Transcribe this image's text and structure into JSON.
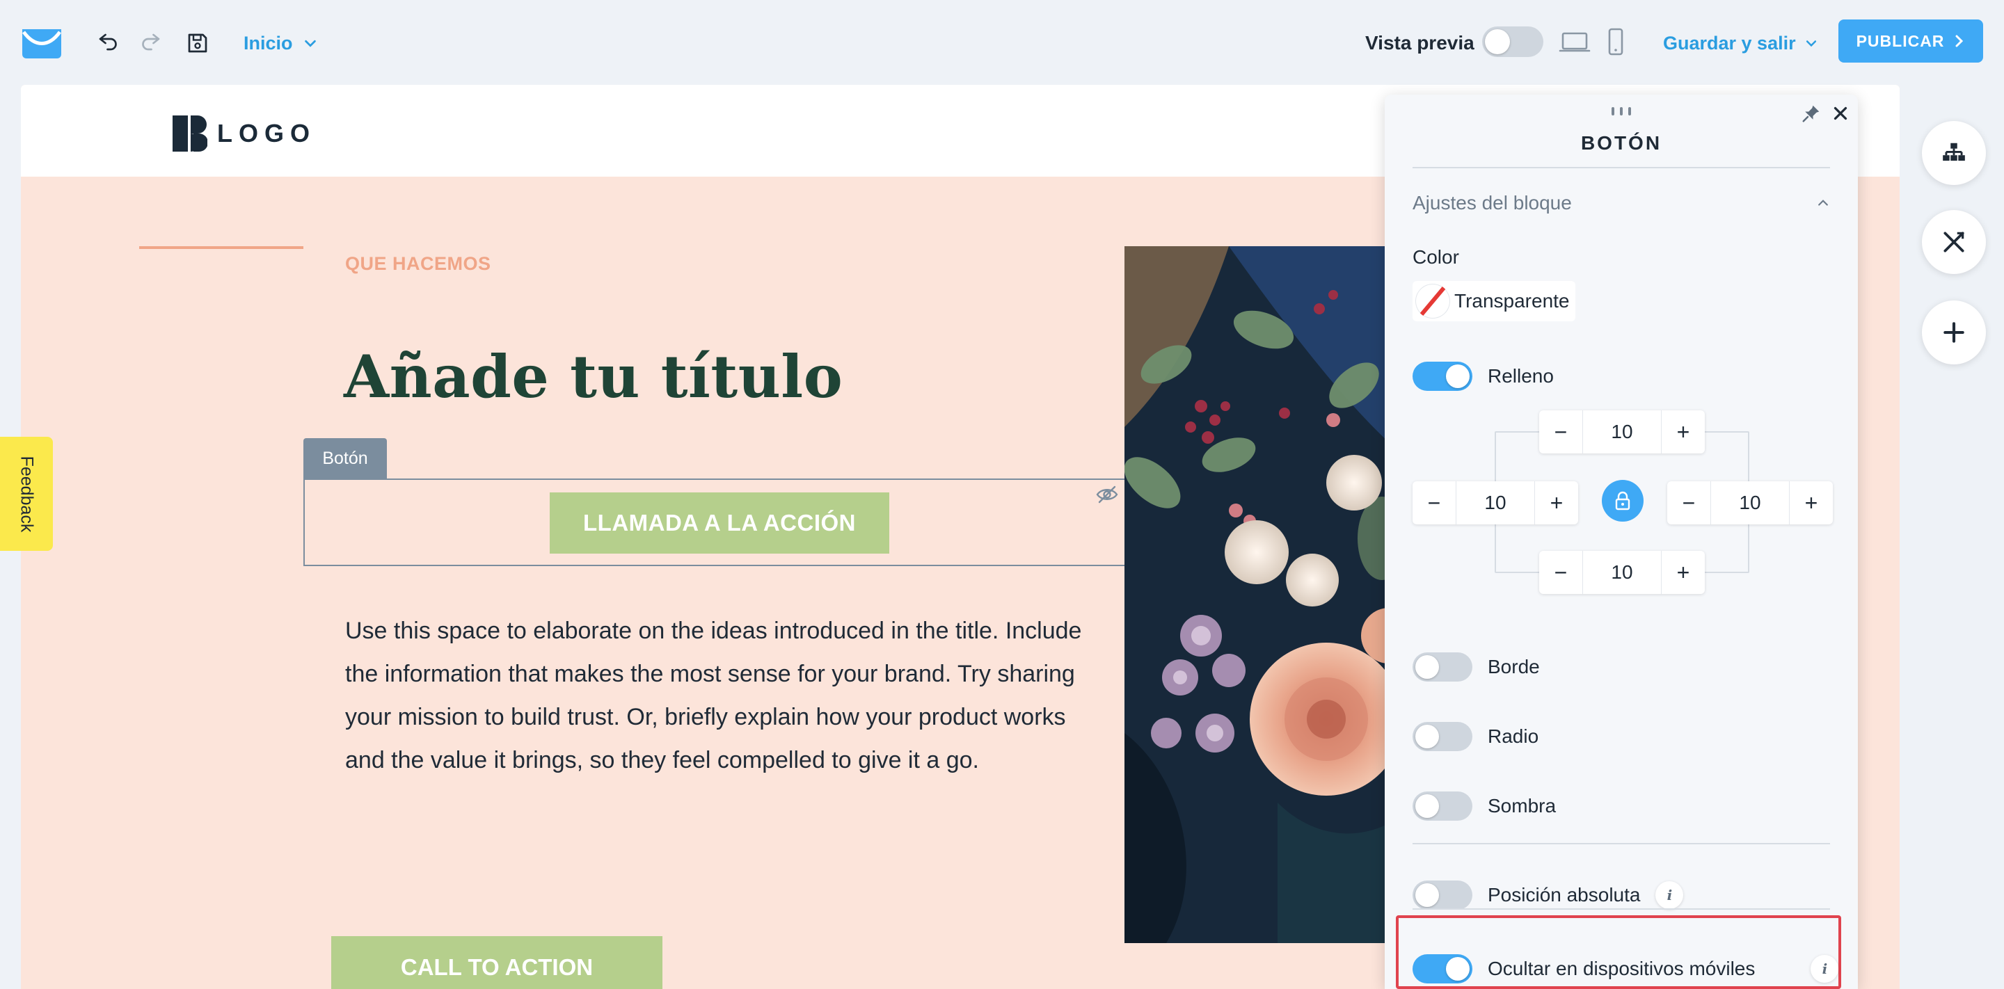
{
  "toolbar": {
    "page_name": "Inicio",
    "preview_label": "Vista previa",
    "preview_on": false,
    "save_exit_label": "Guardar y salir",
    "publish_label": "PUBLICAR"
  },
  "site": {
    "logo_text": "LOGO",
    "eyebrow": "QUE HACEMOS",
    "title": "Añade tu título",
    "block_tag": "Botón",
    "cta_main": "LLAMADA A LA ACCIÓN",
    "body": "Use this space to elaborate on the ideas introduced in the title. Include the information that makes the most sense for your brand. Try sharing your mission to build trust. Or, briefly explain how your product works and the value it brings, so they feel compelled to give it a go.",
    "cta_secondary": "CALL TO ACTION",
    "feedback_label": "Feedback"
  },
  "panel": {
    "title": "BOTÓN",
    "section_title": "Ajustes del bloque",
    "color_label": "Color",
    "color_value": "Transparente",
    "padding_label": "Relleno",
    "padding": {
      "top": "10",
      "left": "10",
      "right": "10",
      "bottom": "10"
    },
    "toggles": [
      {
        "label": "Relleno",
        "on": true
      },
      {
        "label": "Borde",
        "on": false
      },
      {
        "label": "Radio",
        "on": false
      },
      {
        "label": "Sombra",
        "on": false
      },
      {
        "label": "Posición absoluta",
        "on": false
      },
      {
        "label": "Ocultar en dispositivos móviles",
        "on": true
      }
    ]
  },
  "colors": {
    "accent": "#3fa9f5",
    "cta_green": "#b5cf8c",
    "canvas_bg": "#fce4da",
    "title_green": "#1f4436",
    "highlight": "#e0434e"
  }
}
